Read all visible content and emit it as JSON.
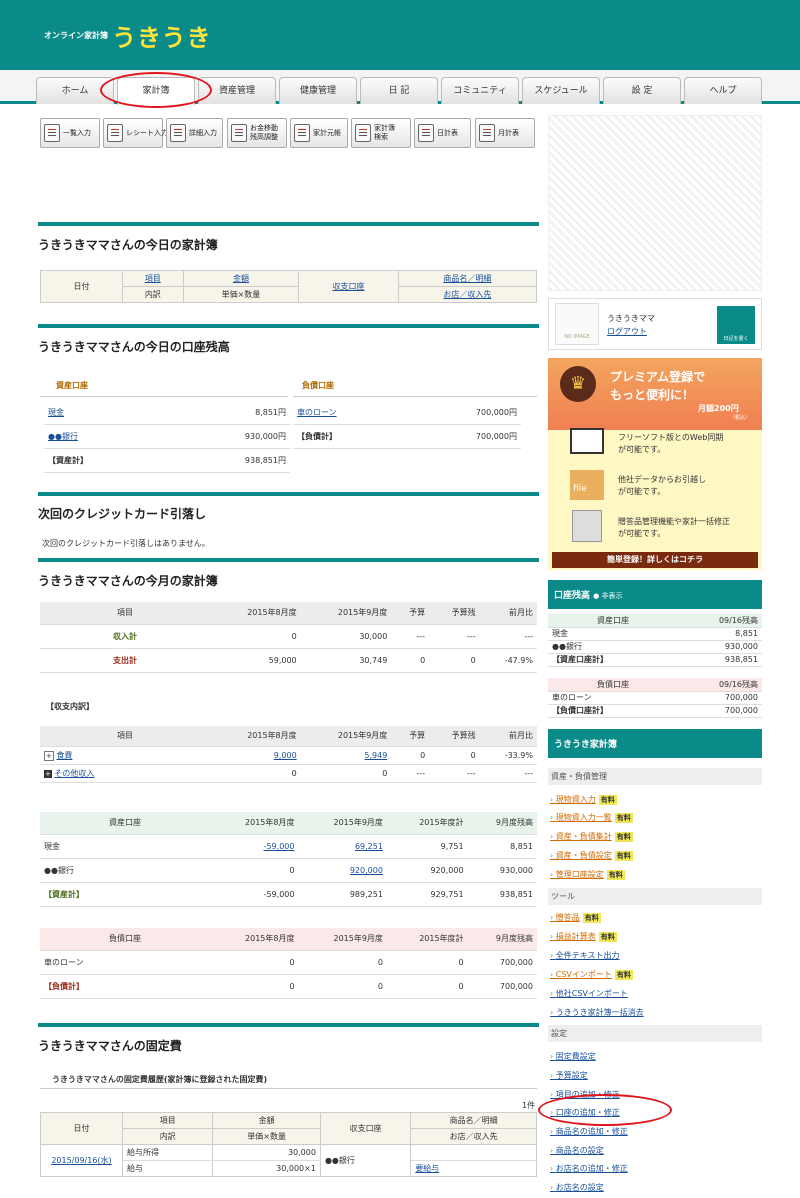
{
  "header": {
    "subtitle": "オンライン家計簿",
    "logo": "うきうき"
  },
  "nav": {
    "tabs": [
      "ホーム",
      "家計簿",
      "資産管理",
      "健康管理",
      "日 記",
      "コミュニティ",
      "スケジュール",
      "設 定",
      "ヘルプ"
    ]
  },
  "toolbar": {
    "buttons": [
      "一覧入力",
      "レシート入力",
      "詳細入力",
      "お金移動\n残高調整",
      "家計元帳",
      "家計簿\n検索",
      "日計表",
      "月計表"
    ]
  },
  "today": {
    "title": "うきうきママさんの今日の家計簿",
    "col_date": "日付",
    "col_item": "項目",
    "col_detail": "内訳",
    "col_amount": "金額",
    "col_unit": "単価×数量",
    "col_account": "収支口座",
    "col_product": "商品名／明細",
    "col_shop": "お店／収入先"
  },
  "balance": {
    "title": "うきうきママさんの今日の口座残高",
    "asset_head": "資産口座",
    "debt_head": "負債口座",
    "assets": [
      {
        "name": "現金",
        "value": "8,851円"
      },
      {
        "name": "●●銀行",
        "value": "930,000円"
      }
    ],
    "asset_total_label": "【資産計】",
    "asset_total": "938,851円",
    "debts": [
      {
        "name": "車のローン",
        "value": "700,000円"
      }
    ],
    "debt_total_label": "【負債計】",
    "debt_total": "700,000円"
  },
  "credit": {
    "title": "次回のクレジットカード引落し",
    "message": "次回のクレジットカード引落しはありません。"
  },
  "monthly": {
    "title": "うきうきママさんの今月の家計簿",
    "headers": [
      "項目",
      "2015年8月度",
      "2015年9月度",
      "予算",
      "予算残",
      "前月比"
    ],
    "rows": [
      [
        "収入計",
        "0",
        "30,000",
        "---",
        "---",
        "---"
      ],
      [
        "支出計",
        "59,000",
        "30,749",
        "0",
        "0",
        "-47.9%"
      ]
    ],
    "breakdown_title": "【収支内訳】",
    "breakdown": [
      [
        "食費",
        "9,000",
        "5,949",
        "0",
        "0",
        "-33.9%"
      ],
      [
        "その他収入",
        "0",
        "0",
        "---",
        "---",
        "---"
      ]
    ],
    "asset_headers": [
      "資産口座",
      "2015年8月度",
      "2015年9月度",
      "2015年度計",
      "9月度残高"
    ],
    "asset_rows": [
      [
        "現金",
        "-59,000",
        "69,251",
        "9,751",
        "8,851"
      ],
      [
        "●●銀行",
        "0",
        "920,000",
        "920,000",
        "930,000"
      ],
      [
        "【資産計】",
        "-59,000",
        "989,251",
        "929,751",
        "938,851"
      ]
    ],
    "debt_headers": [
      "負債口座",
      "2015年8月度",
      "2015年9月度",
      "2015年度計",
      "9月度残高"
    ],
    "debt_rows": [
      [
        "車のローン",
        "0",
        "0",
        "0",
        "700,000"
      ],
      [
        "【負債計】",
        "0",
        "0",
        "0",
        "700,000"
      ]
    ]
  },
  "fixed": {
    "title": "うきうきママさんの固定費",
    "subtitle": "うきうきママさんの固定費履歴(家計簿に登録された固定費)",
    "count": "1件",
    "date": "2015/09/16(水)",
    "item1": "給与所得",
    "item2": "給与",
    "amount": "30,000",
    "unit": "30,000×1",
    "account": "●●銀行",
    "product": "要給与"
  },
  "sidebar": {
    "no_image": "NO IMAGE",
    "user": "うきうきママ",
    "logout": "ログアウト",
    "diary_btn": "日記を書く",
    "premium": {
      "title1": "プレミアム登録で",
      "title2": "もっと便利に！",
      "price": "月額200円",
      "tax": "（税込）",
      "f1a": "フリーソフト版とのWeb同期",
      "f1b": "が可能です。",
      "f2a": "他社データからお引越し",
      "f2b": "が可能です。",
      "f3a": "贈答品管理機能や家計一括修正",
      "f3b": "が可能です。",
      "cta": "簡単登録！詳しくはコチラ",
      "file": "file"
    },
    "acct_title": "口座残高",
    "hide": "非表示",
    "asset_head": "資産口座",
    "asset_date": "09/16残高",
    "assets": [
      [
        "現金",
        "8,851"
      ],
      [
        "●●銀行",
        "930,000"
      ],
      [
        "【資産口座計】",
        "938,851"
      ]
    ],
    "debt_head": "負債口座",
    "debt_date": "09/16残高",
    "debts": [
      [
        "車のローン",
        "700,000"
      ],
      [
        "【負債口座計】",
        "700,000"
      ]
    ],
    "menu_title": "うきうき家計簿",
    "sec1": "資産・負債管理",
    "links1": [
      "現物資入力",
      "現物資入力一覧",
      "資産・負債集計",
      "資産・負債設定",
      "管理口座設定"
    ],
    "paid": "有料",
    "sec2": "ツール",
    "links2": [
      "贈答品",
      "損益計算表",
      "全件テキスト出力",
      "CSVインポート",
      "他社CSVインポート",
      "うきうき家計簿一括消去"
    ],
    "sec3": "設定",
    "links3": [
      "固定費設定",
      "予算設定",
      "項目の追加・修正",
      "口座の追加・修正",
      "商品名の追加・修正",
      "商品名の設定",
      "お店名の追加・修正",
      "お店名の設定"
    ]
  }
}
